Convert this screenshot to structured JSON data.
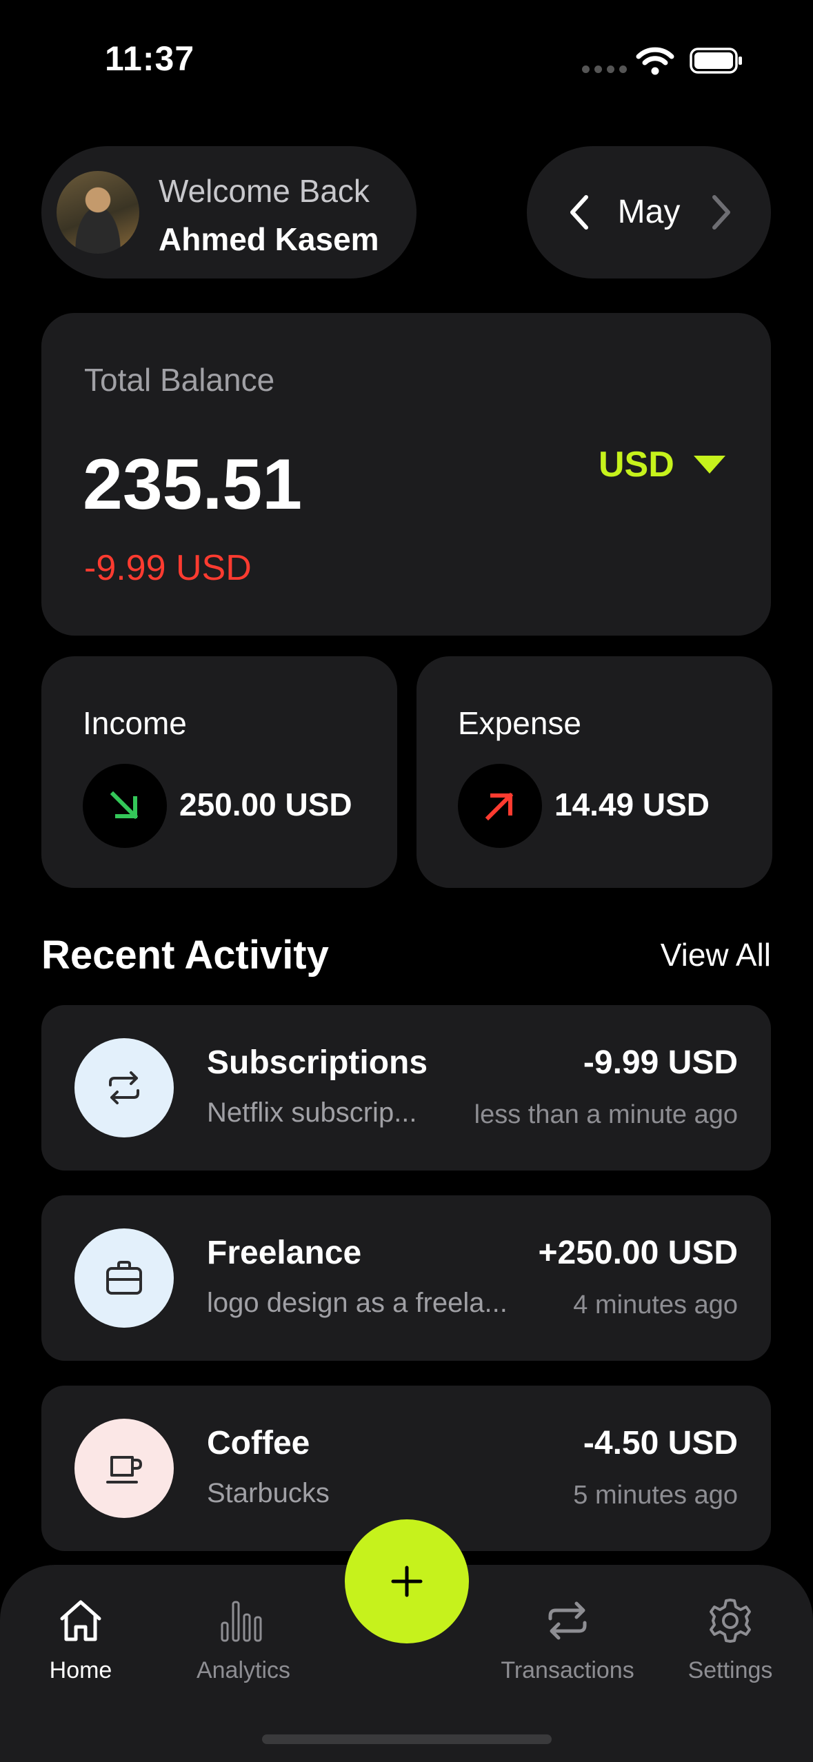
{
  "status_bar": {
    "time": "11:37"
  },
  "header": {
    "welcome_label": "Welcome Back",
    "user_name": "Ahmed Kasem",
    "month": "May"
  },
  "balance": {
    "label": "Total Balance",
    "value": "235.51",
    "change": "-9.99 USD",
    "currency": "USD"
  },
  "income": {
    "label": "Income",
    "value": "250.00 USD"
  },
  "expense": {
    "label": "Expense",
    "value": "14.49 USD"
  },
  "recent": {
    "title": "Recent Activity",
    "view_all": "View All",
    "items": [
      {
        "title": "Subscriptions",
        "description": "Netflix subscrip...",
        "amount": "-9.99 USD",
        "time": "less than a minute ago",
        "icon": "repeat-icon"
      },
      {
        "title": "Freelance",
        "description": "logo design as a freela...",
        "amount": "+250.00 USD",
        "time": "4 minutes ago",
        "icon": "briefcase-icon"
      },
      {
        "title": "Coffee",
        "description": "Starbucks",
        "amount": "-4.50 USD",
        "time": "5 minutes ago",
        "icon": "coffee-cup-icon"
      }
    ]
  },
  "nav": {
    "home": "Home",
    "analytics": "Analytics",
    "transactions": "Transactions",
    "settings": "Settings"
  },
  "colors": {
    "accent": "#c6f21c",
    "negative": "#ff3b30",
    "positive": "#34c759",
    "card": "#1c1c1e",
    "background": "#000000"
  }
}
